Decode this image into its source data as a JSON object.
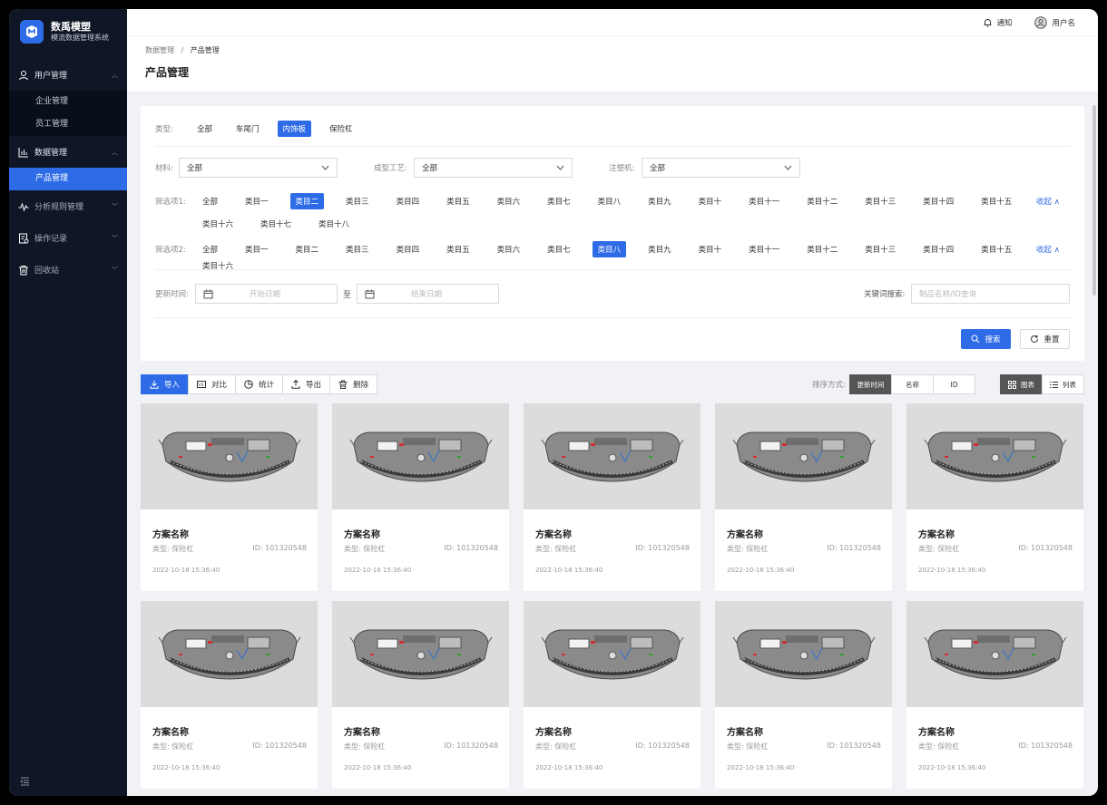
{
  "brand": {
    "title": "数禹模塑",
    "subtitle": "模流数据管理系统"
  },
  "sidebar": {
    "groups": [
      {
        "label": "用户管理",
        "icon": "user-icon",
        "expanded": true,
        "items": [
          {
            "label": "企业管理",
            "active": false
          },
          {
            "label": "员工管理",
            "active": false
          }
        ]
      },
      {
        "label": "数据管理",
        "icon": "bar-chart-icon",
        "expanded": true,
        "items": [
          {
            "label": "产品管理",
            "active": true
          }
        ]
      },
      {
        "label": "分析规则管理",
        "icon": "pulse-icon",
        "expanded": false
      },
      {
        "label": "操作记录",
        "icon": "record-icon",
        "expanded": false
      },
      {
        "label": "回收站",
        "icon": "trash-icon",
        "expanded": false
      }
    ]
  },
  "topbar": {
    "notice": "通知",
    "user": "用户名"
  },
  "breadcrumb": {
    "parent": "数据管理",
    "separator": "/",
    "current": "产品管理"
  },
  "page_title": "产品管理",
  "filter": {
    "type": {
      "label": "类型:",
      "options": [
        "全部",
        "车尾门",
        "内饰板",
        "保险杠"
      ],
      "selected": 2
    },
    "material": {
      "label": "材料:",
      "value": "全部"
    },
    "process": {
      "label": "成型工艺:",
      "value": "全部"
    },
    "machine": {
      "label": "注塑机:",
      "value": "全部"
    },
    "opt1": {
      "label": "筛选项1:",
      "options": [
        "全部",
        "类目一",
        "类目二",
        "类目三",
        "类目四",
        "类目五",
        "类目六",
        "类目七",
        "类目八",
        "类目九",
        "类目十",
        "类目十一",
        "类目十二",
        "类目十三",
        "类目十四",
        "类目十五",
        "类目十六",
        "类目十七",
        "类目十八"
      ],
      "selected": 2
    },
    "opt2": {
      "label": "筛选项2:",
      "options": [
        "全部",
        "类目一",
        "类目二",
        "类目三",
        "类目四",
        "类目五",
        "类目六",
        "类目七",
        "类目八",
        "类目九",
        "类目十",
        "类目十一",
        "类目十二",
        "类目十三",
        "类目十四",
        "类目十五",
        "类目十六"
      ],
      "selected": 8
    },
    "fold": "收起",
    "date_label": "更新时间:",
    "start_placeholder": "开始日期",
    "to": "至",
    "end_placeholder": "结束日期",
    "keyword_label": "关键词搜索:",
    "keyword_placeholder": "制品名称/ID查询",
    "search": "搜索",
    "reset": "重置"
  },
  "toolbar": {
    "import": "导入",
    "compare": "对比",
    "stats": "统计",
    "export": "导出",
    "delete": "删除",
    "sort_label": "排序方式:",
    "sort_options": [
      "更新时间",
      "名称",
      "ID"
    ],
    "sort_selected": 0,
    "view_chart": "图表",
    "view_list": "列表"
  },
  "cards": [
    {
      "name": "方案名称",
      "type": "类型:  保险杠",
      "id": "ID:  101320548",
      "time": "2022-10-18  15:36:40"
    },
    {
      "name": "方案名称",
      "type": "类型:  保险杠",
      "id": "ID:  101320548",
      "time": "2022-10-18  15:36:40"
    },
    {
      "name": "方案名称",
      "type": "类型:  保险杠",
      "id": "ID:  101320548",
      "time": "2022-10-18  15:36:40"
    },
    {
      "name": "方案名称",
      "type": "类型:  保险杠",
      "id": "ID:  101320548",
      "time": "2022-10-18  15:36:40"
    },
    {
      "name": "方案名称",
      "type": "类型:  保险杠",
      "id": "ID:  101320548",
      "time": "2022-10-18  15:36:40"
    },
    {
      "name": "方案名称",
      "type": "类型:  保险杠",
      "id": "ID:  101320548",
      "time": "2022-10-18  15:36:40"
    },
    {
      "name": "方案名称",
      "type": "类型:  保险杠",
      "id": "ID:  101320548",
      "time": "2022-10-18  15:36:40"
    },
    {
      "name": "方案名称",
      "type": "类型:  保险杠",
      "id": "ID:  101320548",
      "time": "2022-10-18  15:36:40"
    },
    {
      "name": "方案名称",
      "type": "类型:  保险杠",
      "id": "ID:  101320548",
      "time": "2022-10-18  15:36:40"
    },
    {
      "name": "方案名称",
      "type": "类型:  保险杠",
      "id": "ID:  101320548",
      "time": "2022-10-18  15:36:40"
    }
  ],
  "colors": {
    "accent": "#2e6be6",
    "sidebar": "#0f1727"
  }
}
